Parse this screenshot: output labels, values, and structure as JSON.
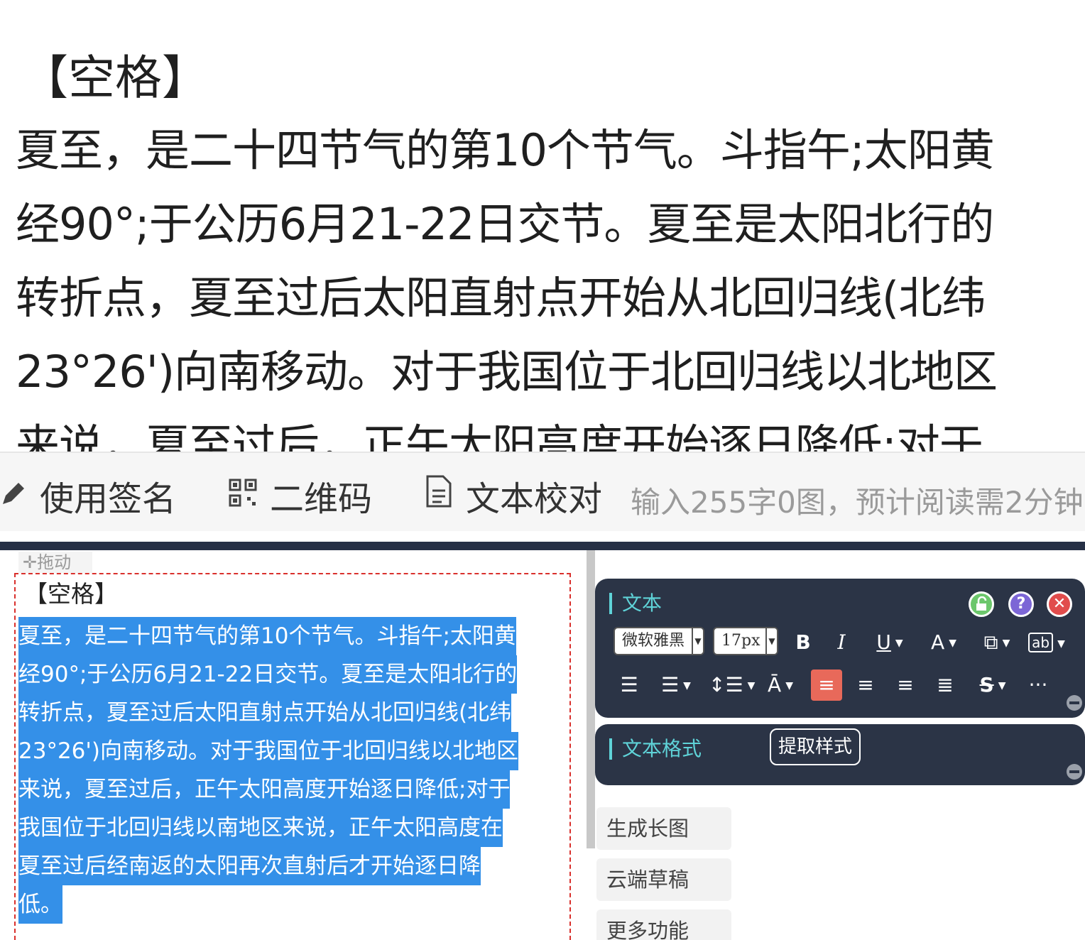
{
  "preview": {
    "heading": "【空格】",
    "lines": [
      "夏至，是二十四节气的第10个节气。斗指午;太阳黄",
      "经90°;于公历6月21-22日交节。夏至是太阳北行的",
      "转折点，夏至过后太阳直射点开始从北回归线(北纬",
      "23°26')向南移动。对于我国位于北回归线以北地区",
      "来说，夏至过后，正午太阳高度开始逐日降低;对于"
    ]
  },
  "footer": {
    "signature": "使用签名",
    "qrcode": "二维码",
    "proofread": "文本校对",
    "stats": "输入255字0图，预计阅读需2分钟"
  },
  "editor": {
    "drag_label": "拖动",
    "heading": "【空格】",
    "selected_lines": [
      "夏至，是二十四节气的第10个节气。斗指午;太阳黄",
      "经90°;于公历6月21-22日交节。夏至是太阳北行的",
      "转折点，夏至过后太阳直射点开始从北回归线(北纬",
      "23°26')向南移动。对于我国位于北回归线以北地区",
      "来说，夏至过后，正午太阳高度开始逐日降低;对于",
      "我国位于北回归线以南地区来说，正午太阳高度在",
      "夏至过后经南返的太阳再次直射后才开始逐日降",
      "低。"
    ]
  },
  "side_menu": {
    "items": [
      "生成长图",
      "云端草稿",
      "更多功能"
    ]
  },
  "text_panel": {
    "title": "文本",
    "font_family": "微软雅黑",
    "font_size": "17px",
    "bold": "B",
    "italic": "I",
    "underline": "U",
    "font_color": "A",
    "more": "···"
  },
  "format_panel": {
    "title": "文本格式",
    "extract_button": "提取样式"
  },
  "colors": {
    "panel_bg": "#2b3446",
    "accent": "#5fd3d8",
    "selection": "#3490e8",
    "active_align": "#e8695a"
  }
}
